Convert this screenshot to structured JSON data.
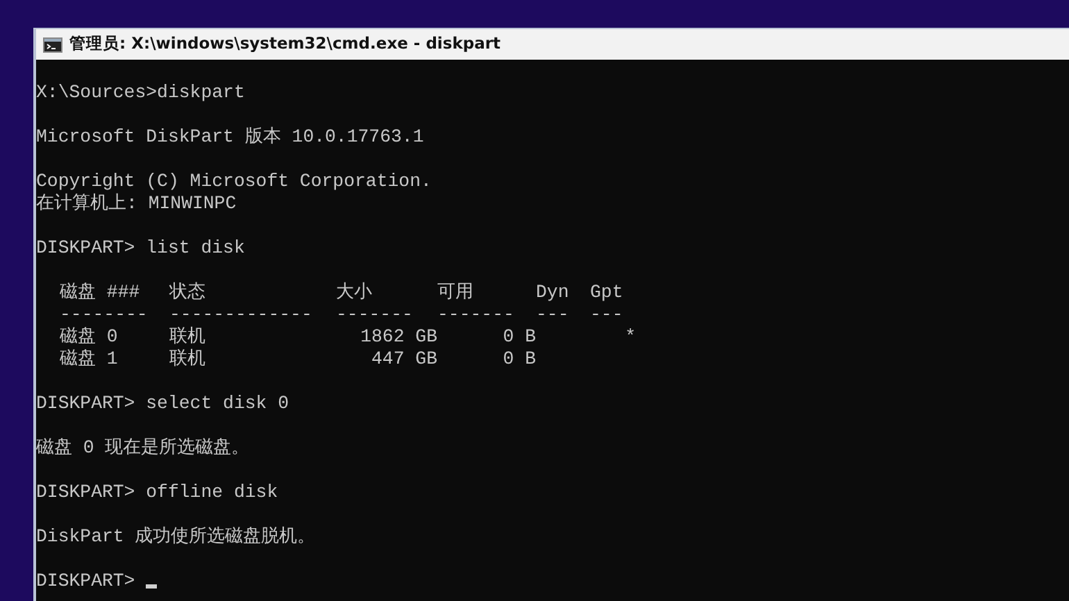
{
  "window": {
    "title": "管理员: X:\\windows\\system32\\cmd.exe - diskpart"
  },
  "console": {
    "blocks_before_table": [
      [
        "X:\\Sources>diskpart"
      ],
      [
        "Microsoft DiskPart 版本 10.0.17763.1"
      ],
      [
        "Copyright (C) Microsoft Corporation.",
        "在计算机上: MINWINPC"
      ],
      [
        "DISKPART> list disk"
      ]
    ],
    "table": {
      "columns": [
        {
          "header": "磁盘 ###",
          "rule": "--------"
        },
        {
          "header": "状态",
          "rule": "-------------"
        },
        {
          "header": "大小",
          "rule": "-------"
        },
        {
          "header": "可用",
          "rule": "-------"
        },
        {
          "header": "Dyn",
          "rule": "---"
        },
        {
          "header": "Gpt",
          "rule": "---"
        }
      ],
      "rows": [
        [
          "磁盘 0",
          "联机",
          "1862 GB",
          "0 B",
          null,
          "*"
        ],
        [
          "磁盘 1",
          "联机",
          "447 GB",
          "0 B",
          null,
          null
        ]
      ]
    },
    "blocks_after_table": [
      [
        "DISKPART> select disk 0"
      ],
      [
        "磁盘 0 现在是所选磁盘。"
      ],
      [
        "DISKPART> offline disk"
      ],
      [
        "DiskPart 成功使所选磁盘脱机。"
      ]
    ],
    "prompt": "DISKPART>"
  }
}
